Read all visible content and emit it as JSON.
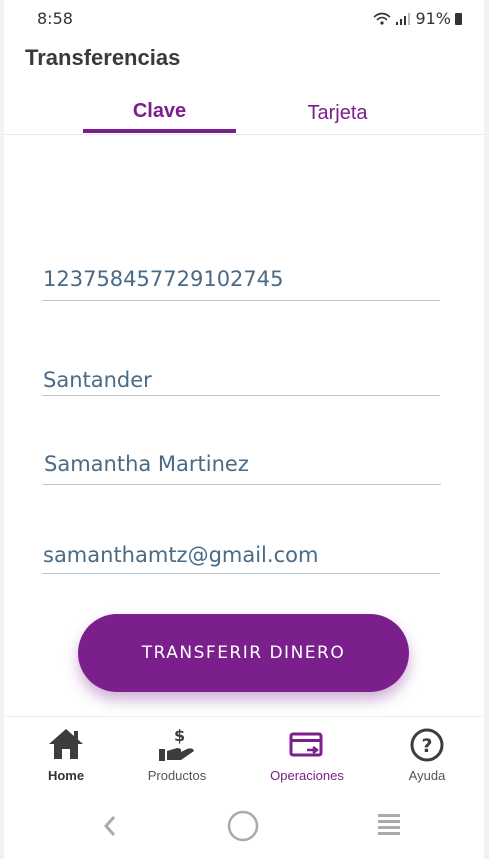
{
  "status_bar": {
    "time": "8:58",
    "battery": "91%"
  },
  "header": {
    "title": "Transferencias"
  },
  "tabs": [
    {
      "label": "Clave",
      "active": true
    },
    {
      "label": "Tarjeta",
      "active": false
    }
  ],
  "form": {
    "account": "123758457729102745",
    "bank": "Santander",
    "name": "Samantha Martinez",
    "email": "samanthamtz@gmail.com"
  },
  "transfer_button": {
    "label": "TRANSFERIR DINERO"
  },
  "bottom_nav": {
    "items": [
      {
        "label": "Home",
        "icon": "home-icon"
      },
      {
        "label": "Productos",
        "icon": "hand-money-icon"
      },
      {
        "label": "Operaciones",
        "icon": "transfer-card-icon",
        "active": true
      },
      {
        "label": "Ayuda",
        "icon": "help-icon"
      }
    ]
  },
  "colors": {
    "accent": "#7b1f8c",
    "field_text": "#4a6a86"
  }
}
